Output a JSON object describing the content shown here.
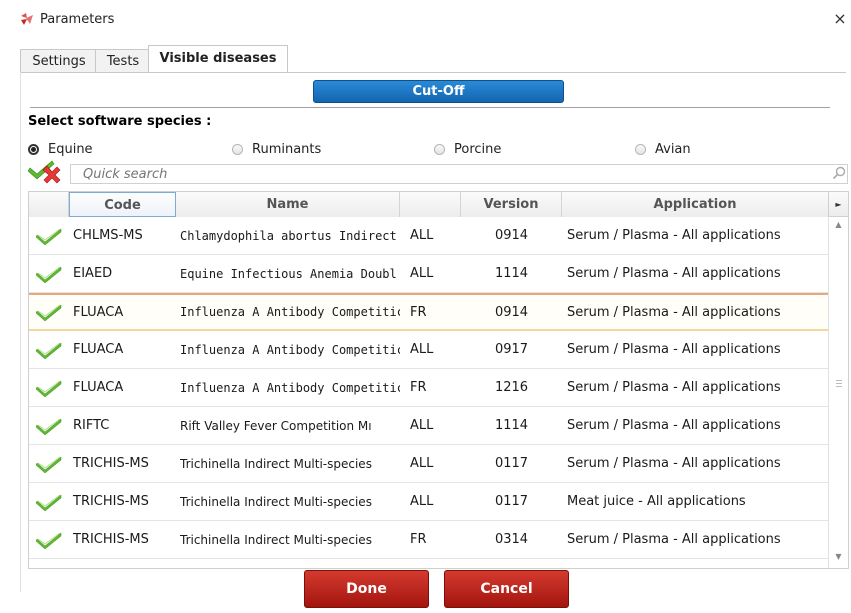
{
  "window": {
    "title": "Parameters",
    "close_glyph": "×"
  },
  "tabs": [
    {
      "label": "Settings",
      "active": false
    },
    {
      "label": "Tests",
      "active": false
    },
    {
      "label": "Visible diseases",
      "active": true
    }
  ],
  "cutoff_button": "Cut-Off",
  "species": {
    "title": "Select software species :",
    "options": [
      {
        "label": "Equine",
        "checked": true
      },
      {
        "label": "Ruminants",
        "checked": false
      },
      {
        "label": "Porcine",
        "checked": false
      },
      {
        "label": "Avian",
        "checked": false
      }
    ]
  },
  "search": {
    "placeholder": "Quick search",
    "value": ""
  },
  "grid": {
    "columns": [
      "",
      "Code",
      "Name",
      "",
      "Version",
      "Application"
    ],
    "column_menu_glyph": "►",
    "rows": [
      {
        "code": "CHLMS-MS",
        "name": "Chlamydophila abortus Indirect",
        "country": "ALL",
        "version": "0914",
        "application": "Serum / Plasma - All applications"
      },
      {
        "code": "EIAED",
        "name": "Equine Infectious Anemia Doubl",
        "country": "ALL",
        "version": "1114",
        "application": "Serum / Plasma - All applications"
      },
      {
        "code": "FLUACA",
        "name": "Influenza A Antibody Competitic",
        "country": "FR",
        "version": "0914",
        "application": "Serum / Plasma - All applications"
      },
      {
        "code": "FLUACA",
        "name": "Influenza A Antibody Competitic",
        "country": "ALL",
        "version": "0917",
        "application": "Serum / Plasma - All applications"
      },
      {
        "code": "FLUACA",
        "name": "Influenza A Antibody Competitic",
        "country": "FR",
        "version": "1216",
        "application": "Serum / Plasma - All applications"
      },
      {
        "code": "RIFTC",
        "name": "Rift Valley Fever Competition Mı",
        "country": "ALL",
        "version": "1114",
        "application": "Serum / Plasma - All applications"
      },
      {
        "code": "TRICHIS-MS",
        "name": "Trichinella Indirect Multi-species",
        "country": "ALL",
        "version": "0117",
        "application": "Serum / Plasma - All applications"
      },
      {
        "code": "TRICHIS-MS",
        "name": "Trichinella Indirect Multi-species",
        "country": "ALL",
        "version": "0117",
        "application": "Meat juice - All applications"
      },
      {
        "code": "TRICHIS-MS",
        "name": "Trichinella Indirect Multi-species",
        "country": "FR",
        "version": "0314",
        "application": "Serum / Plasma - All applications"
      }
    ],
    "selected_row_index": 2
  },
  "scrollbar": {
    "up_glyph": "▲",
    "down_glyph": "▼"
  },
  "buttons": {
    "done": "Done",
    "cancel": "Cancel"
  },
  "colors": {
    "accent_blue": "#1a72c4",
    "button_red": "#b8231a",
    "check_green": "#5fb832",
    "selection_orange": "#e8a87c"
  }
}
